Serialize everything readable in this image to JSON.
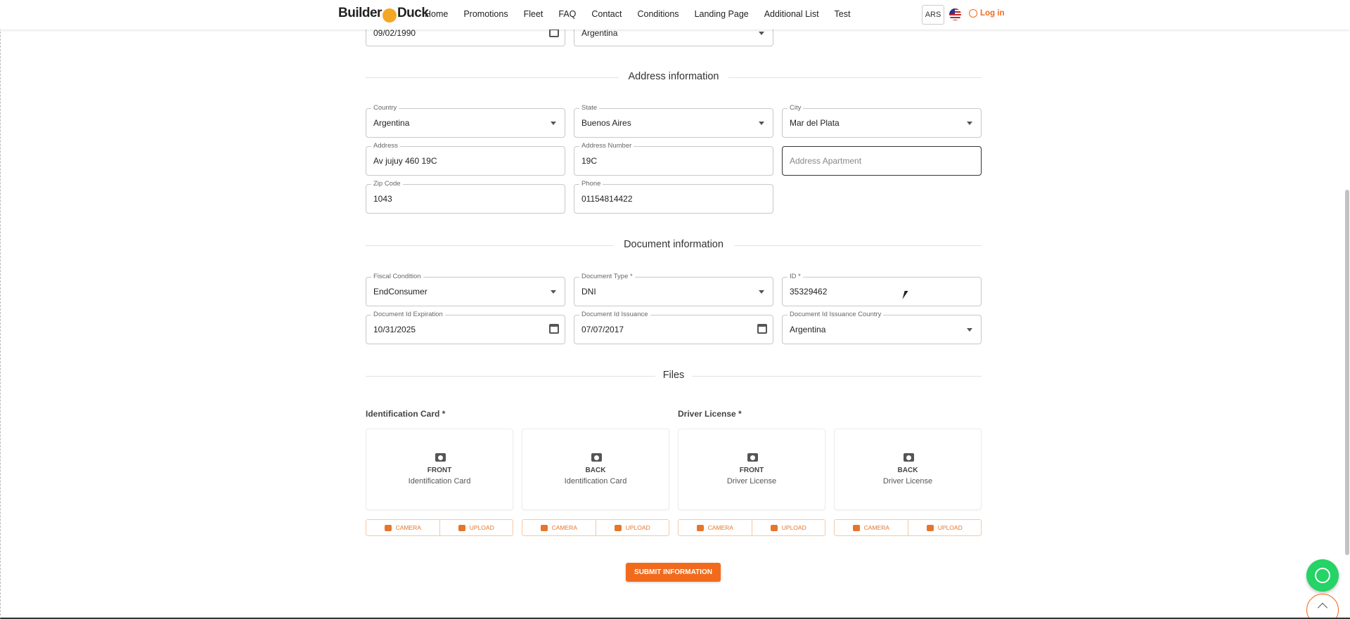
{
  "nav": {
    "logo_left": "Builder",
    "logo_right": "Duck",
    "links": [
      "Home",
      "Promotions",
      "Fleet",
      "FAQ",
      "Contact",
      "Conditions",
      "Landing Page",
      "Additional List",
      "Test"
    ],
    "currency": "ARS",
    "login": "Log in"
  },
  "top_partial": {
    "birth_date": "09/02/1990",
    "nationality": "Argentina"
  },
  "address_section": {
    "title": "Address information",
    "country": {
      "label": "Country",
      "value": "Argentina"
    },
    "state": {
      "label": "State",
      "value": "Buenos Aires"
    },
    "city": {
      "label": "City",
      "value": "Mar del Plata"
    },
    "address": {
      "label": "Address",
      "value": "Av jujuy 460 19C"
    },
    "address_number": {
      "label": "Address Number",
      "value": "19C"
    },
    "address_apartment": {
      "placeholder": "Address Apartment"
    },
    "zip": {
      "label": "Zip Code",
      "value": "1043"
    },
    "phone": {
      "label": "Phone",
      "value": "01154814422"
    }
  },
  "document_section": {
    "title": "Document information",
    "fiscal": {
      "label": "Fiscal Condition",
      "value": "EndConsumer"
    },
    "doc_type": {
      "label": "Document Type *",
      "value": "DNI"
    },
    "id": {
      "label": "ID *",
      "value": "35329462"
    },
    "expiration": {
      "label": "Document Id Expiration",
      "value": "10/31/2025"
    },
    "issuance": {
      "label": "Document Id Issuance",
      "value": "07/07/2017"
    },
    "issuance_country": {
      "label": "Document Id Issuance Country",
      "value": "Argentina"
    }
  },
  "files_section": {
    "title": "Files",
    "id_card_label": "Identification Card *",
    "license_label": "Driver License *",
    "cards": [
      {
        "side": "FRONT",
        "doc": "Identification Card"
      },
      {
        "side": "BACK",
        "doc": "Identification Card"
      },
      {
        "side": "FRONT",
        "doc": "Driver License"
      },
      {
        "side": "BACK",
        "doc": "Driver License"
      }
    ],
    "camera_label": "CAMERA",
    "upload_label": "UPLOAD"
  },
  "submit_label": "SUBMIT INFORMATION",
  "colors": {
    "accent": "#f26b1d",
    "whatsapp": "#25d366"
  }
}
